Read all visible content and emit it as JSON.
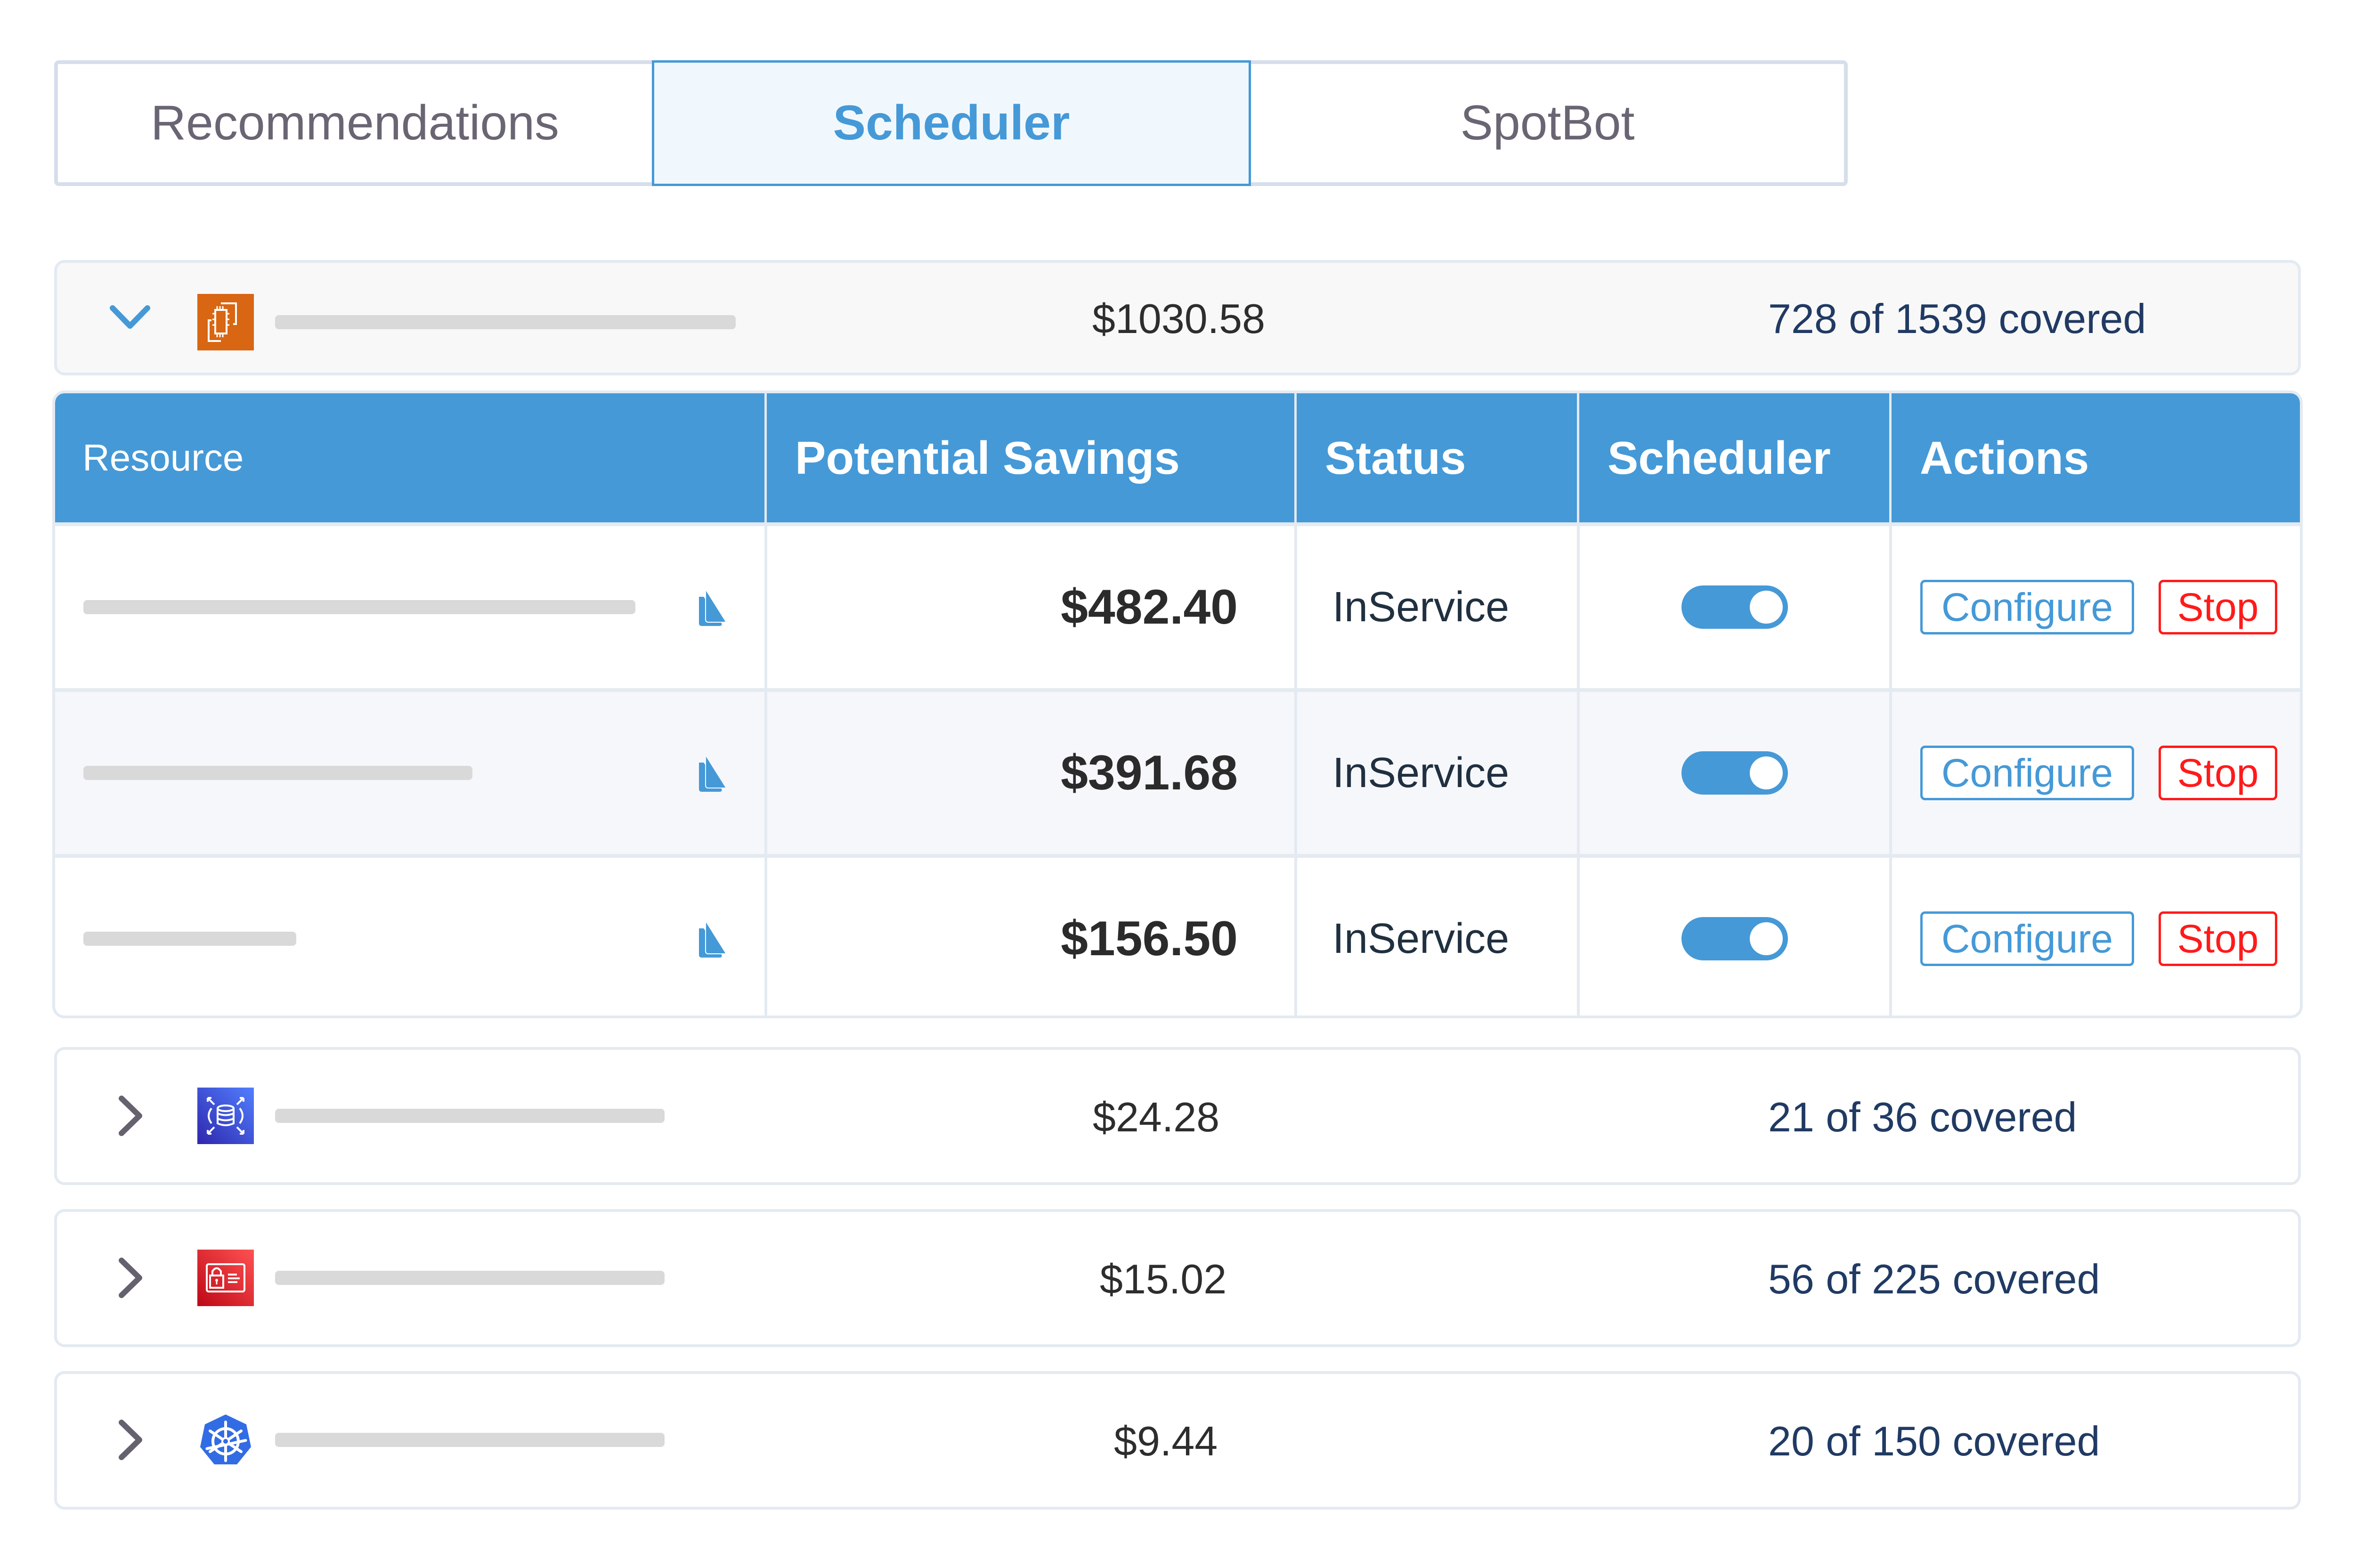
{
  "tabs": [
    {
      "label": "Recommendations",
      "active": false
    },
    {
      "label": "Scheduler",
      "active": true
    },
    {
      "label": "SpotBot",
      "active": false
    }
  ],
  "colors": {
    "accent": "#4599d7",
    "stop": "#ff1a1a",
    "coverage_text": "#203a63",
    "compute_icon": "#d86613",
    "database_icon": "#3b48cc",
    "security_icon": "#dd344c",
    "kubernetes_icon": "#326ce5"
  },
  "groups": [
    {
      "icon": "compute-service-icon",
      "expanded": true,
      "amount": "$1030.58",
      "coverage": "728 of 1539 covered"
    },
    {
      "icon": "database-service-icon",
      "expanded": false,
      "amount": "$24.28",
      "coverage": "21 of 36 covered"
    },
    {
      "icon": "security-service-icon",
      "expanded": false,
      "amount": "$15.02",
      "coverage": "56 of 225 covered"
    },
    {
      "icon": "kubernetes-service-icon",
      "expanded": false,
      "amount": "$9.44",
      "coverage": "20 of 150 covered"
    }
  ],
  "table": {
    "headers": [
      "Resource",
      "Potential Savings",
      "Status",
      "Scheduler",
      "Actions"
    ],
    "rows": [
      {
        "resource_icon": "sagemaker-icon",
        "savings": "$482.40",
        "status": "InService",
        "scheduler_on": true,
        "configure_label": "Configure",
        "stop_label": "Stop"
      },
      {
        "resource_icon": "sagemaker-icon",
        "savings": "$391.68",
        "status": "InService",
        "scheduler_on": true,
        "configure_label": "Configure",
        "stop_label": "Stop"
      },
      {
        "resource_icon": "sagemaker-icon",
        "savings": "$156.50",
        "status": "InService",
        "scheduler_on": true,
        "configure_label": "Configure",
        "stop_label": "Stop"
      }
    ]
  }
}
